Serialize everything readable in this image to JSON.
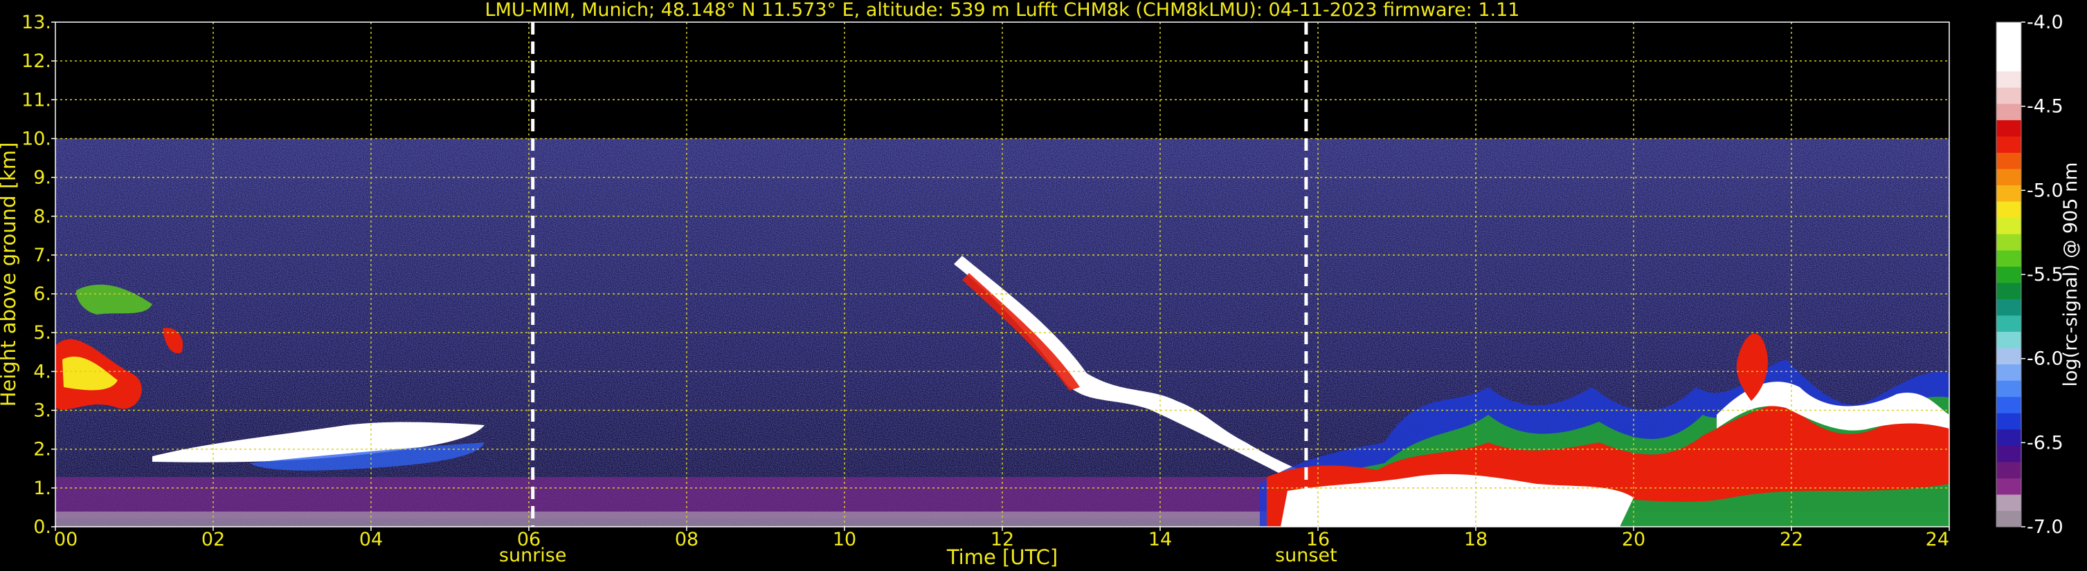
{
  "chart_data": {
    "type": "heatmap",
    "title": "LMU-MIM, Munich; 48.148° N 11.573° E, altitude: 539 m    Lufft CHM8k (CHM8kLMU): 04-11-2023    firmware: 1.11",
    "xlabel": "Time [UTC]",
    "ylabel": "Height above ground [km]",
    "xlim": [
      0,
      24
    ],
    "ylim": [
      0,
      13
    ],
    "xticks": [
      0,
      2,
      4,
      6,
      8,
      10,
      12,
      14,
      16,
      18,
      20,
      22,
      24
    ],
    "xtick_labels": [
      "00",
      "02",
      "04",
      "06",
      "08",
      "10",
      "12",
      "14",
      "16",
      "18",
      "20",
      "22",
      "24"
    ],
    "yticks": [
      0,
      1,
      2,
      3,
      4,
      5,
      6,
      7,
      8,
      9,
      10,
      11,
      12,
      13
    ],
    "ytick_labels": [
      "0.",
      "1.",
      "2.",
      "3.",
      "4.",
      "5.",
      "6.",
      "7.",
      "8.",
      "9.",
      "10.",
      "11.",
      "12.",
      "13."
    ],
    "grid": true,
    "data_ceiling_km": 10,
    "events": [
      {
        "label": "sunrise",
        "time": 6.05
      },
      {
        "label": "sunset",
        "time": 15.85
      }
    ],
    "colorbar": {
      "label": "log(rc-signal) @ 905 nm",
      "range": [
        -7.0,
        -4.0
      ],
      "ticks": [
        -4.0,
        -4.5,
        -5.0,
        -5.5,
        -6.0,
        -6.5,
        -7.0
      ],
      "tick_labels": [
        "-4.0",
        "-4.5",
        "-5.0",
        "-5.5",
        "-6.0",
        "-6.5",
        "-7.0"
      ],
      "colors": [
        "#9e8f9e",
        "#b59fb5",
        "#8a2c8a",
        "#6a1a7a",
        "#48108a",
        "#2a1aa8",
        "#1e3ad6",
        "#2f61f0",
        "#4d88f4",
        "#7aa8f4",
        "#a7c2ec",
        "#7fd6d6",
        "#33b8a8",
        "#14907a",
        "#0f8a3a",
        "#23a823",
        "#5ac81e",
        "#9bdc24",
        "#d8ee2a",
        "#f7e41e",
        "#f8b416",
        "#f5880f",
        "#f05a0c",
        "#e8200c",
        "#d40c0c",
        "#e8a4a4",
        "#f0c8c8",
        "#f7e4e4",
        "#ffffff",
        "#ffffff",
        "#ffffff"
      ]
    }
  }
}
